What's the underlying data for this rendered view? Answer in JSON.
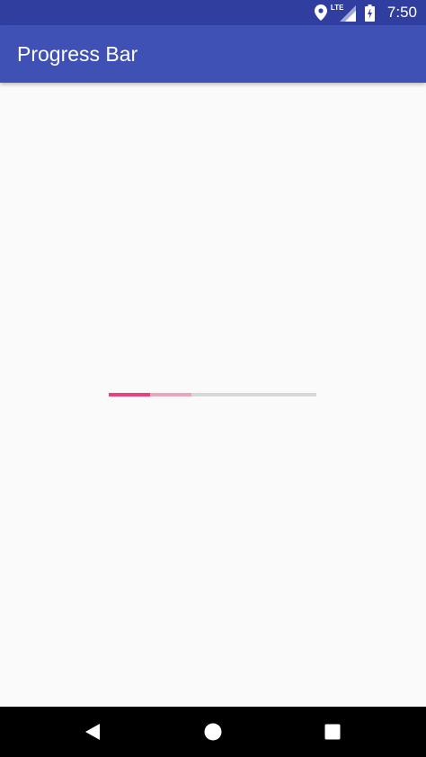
{
  "status_bar": {
    "time": "7:50",
    "network_label": "LTE",
    "icons": [
      "location-icon",
      "lte-signal-icon",
      "battery-charging-icon"
    ]
  },
  "app_bar": {
    "title": "Progress Bar"
  },
  "progress": {
    "primary": 0.2,
    "secondary": 0.4
  },
  "nav_bar": {
    "buttons": [
      "back",
      "home",
      "recents"
    ]
  },
  "colors": {
    "status_bar": "#303f9f",
    "app_bar": "#3f51b5",
    "background": "#fafafa",
    "progress_primary": "#ec407a",
    "progress_secondary": "#e7a8ba",
    "progress_track": "#d8d8d8",
    "nav_bar": "#000000"
  }
}
